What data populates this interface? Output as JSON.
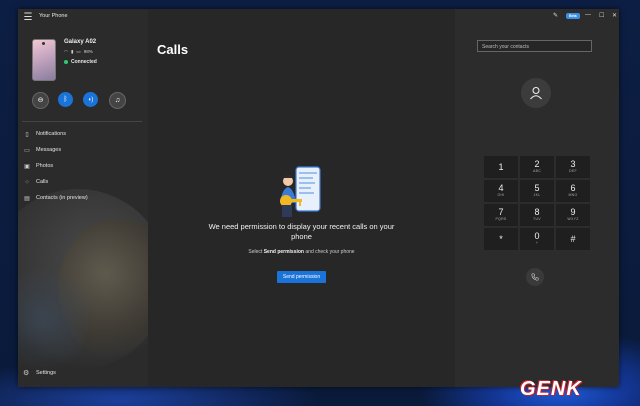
{
  "app": {
    "title": "Your Phone"
  },
  "device": {
    "name": "Galaxy A02",
    "battery": "98%",
    "status": "Connected"
  },
  "quick_actions": [
    {
      "icon": "do-not-disturb-icon",
      "glyph": "⊖"
    },
    {
      "icon": "bluetooth-icon",
      "glyph": "ᛒ"
    },
    {
      "icon": "volume-icon",
      "glyph": "🔊"
    },
    {
      "icon": "music-icon",
      "glyph": "♫"
    }
  ],
  "nav": {
    "items": [
      {
        "label": "Notifications",
        "icon": "bell-icon"
      },
      {
        "label": "Messages",
        "icon": "message-icon"
      },
      {
        "label": "Photos",
        "icon": "photo-icon"
      },
      {
        "label": "Calls",
        "icon": "phone-grid-icon"
      },
      {
        "label": "Contacts (in preview)",
        "icon": "contacts-icon"
      }
    ],
    "settings": "Settings"
  },
  "main": {
    "title": "Calls",
    "message": "We need permission to display your recent calls on your phone",
    "sub_prefix": "Select ",
    "sub_bold": "Send permission",
    "sub_suffix": " and check your phone",
    "button": "Send permission"
  },
  "dialer": {
    "beta_badge": "Beta",
    "search_placeholder": "Search your contacts",
    "keys": [
      {
        "digit": "1",
        "letters": ""
      },
      {
        "digit": "2",
        "letters": "ABC"
      },
      {
        "digit": "3",
        "letters": "DEF"
      },
      {
        "digit": "4",
        "letters": "GHI"
      },
      {
        "digit": "5",
        "letters": "JKL"
      },
      {
        "digit": "6",
        "letters": "MNO"
      },
      {
        "digit": "7",
        "letters": "PQRS"
      },
      {
        "digit": "8",
        "letters": "TUV"
      },
      {
        "digit": "9",
        "letters": "WXYZ"
      },
      {
        "digit": "*",
        "letters": ""
      },
      {
        "digit": "0",
        "letters": "+"
      },
      {
        "digit": "#",
        "letters": ""
      }
    ]
  },
  "watermark": "GENK",
  "colors": {
    "accent": "#1a73d9",
    "connected": "#2ecc71"
  }
}
